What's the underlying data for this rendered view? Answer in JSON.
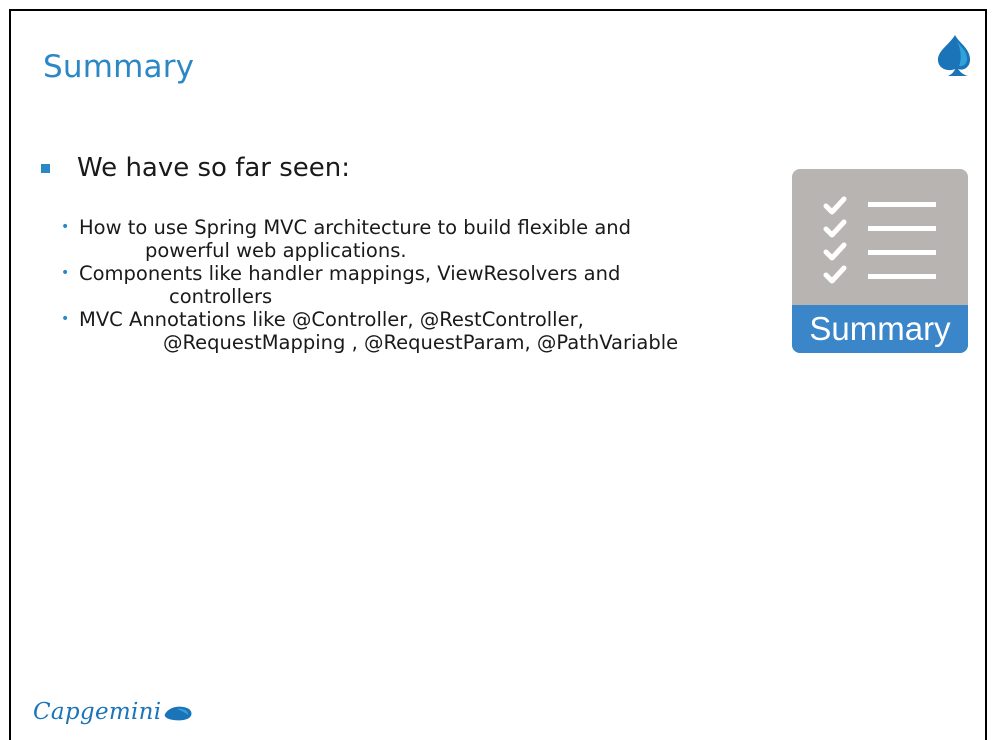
{
  "slide": {
    "title": "Summary",
    "lead": "We have so far seen:",
    "points": [
      {
        "line1": "How to use Spring MVC architecture to build flexible and",
        "line2": "powerful web applications."
      },
      {
        "line1": "Components like handler mappings, ViewResolvers and",
        "line2": "controllers"
      },
      {
        "line1": "MVC Annotations like @Controller, @RestController,",
        "line2": "@RequestMapping , @RequestParam, @PathVariable"
      }
    ]
  },
  "summary_icon": {
    "label": "Summary",
    "icon": "checklist-icon"
  },
  "footer": {
    "brand": "Capgemini",
    "logo_icon": "spade-icon"
  },
  "colors": {
    "title": "#2b87c5",
    "bullet": "#2b87c5",
    "icon_body": "#b8b4b1",
    "icon_band": "#3a86c8",
    "brand": "#1b74b8"
  }
}
